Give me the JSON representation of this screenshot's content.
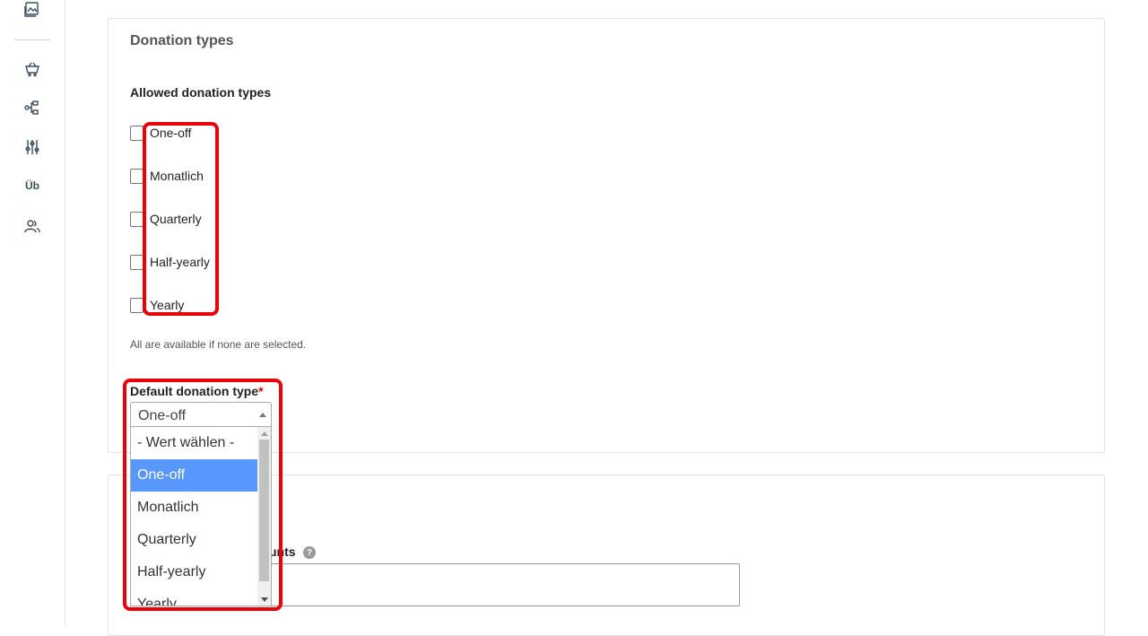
{
  "rail": {
    "icons": [
      "media-icon",
      "shop-icon",
      "workflow-icon",
      "sliders-icon",
      "users-icon"
    ],
    "text_item": "Üb"
  },
  "section": {
    "title": "Donation types",
    "allowed_label": "Allowed donation types",
    "options": [
      {
        "label": "One-off",
        "checked": false
      },
      {
        "label": "Monatlich",
        "checked": false
      },
      {
        "label": "Quarterly",
        "checked": false
      },
      {
        "label": "Half-yearly",
        "checked": false
      },
      {
        "label": "Yearly",
        "checked": false
      }
    ],
    "help_text": "All are available if none are selected.",
    "default_label": "Default donation type",
    "required_marker": "*"
  },
  "select": {
    "value": "One-off",
    "options": [
      "- Wert wählen -",
      "One-off",
      "Monatlich",
      "Quarterly",
      "Half-yearly",
      "Yearly"
    ],
    "selected_index": 1
  },
  "section2": {
    "amounts_label_fragment": "unts",
    "help_icon": "?",
    "input_value": ""
  },
  "colors": {
    "highlight": "#e8000b",
    "option_selected_bg": "#5897fb",
    "required": "#ee0000"
  }
}
